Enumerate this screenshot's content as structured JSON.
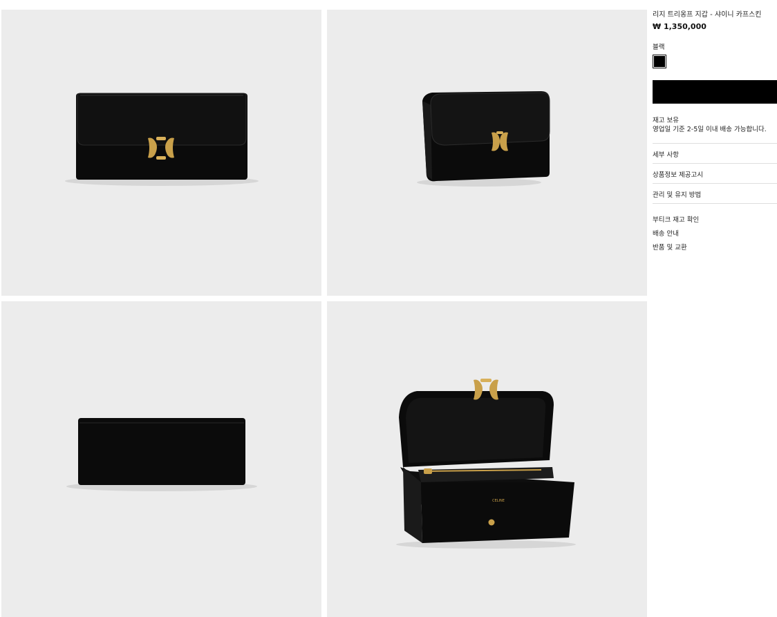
{
  "product": {
    "title": "리지 트리옹프 지갑 - 샤이니 카프스킨",
    "price": "₩ 1,350,000",
    "color_label": "블랙",
    "swatch_color": "#000000",
    "add_button_label": "",
    "stock_status": "재고 보유",
    "shipping_note": "영업일 기준 2-5일 이내 배송 가능합니다."
  },
  "accordion": [
    {
      "label": "세부 사항"
    },
    {
      "label": "상품정보 제공고시"
    },
    {
      "label": "관리 및 유지 방법"
    }
  ],
  "links": [
    {
      "label": "부티크 재고 확인"
    },
    {
      "label": "배송 안내"
    },
    {
      "label": "반품 및 교환"
    }
  ],
  "gallery": {
    "images": [
      {
        "view": "front"
      },
      {
        "view": "side"
      },
      {
        "view": "back"
      },
      {
        "view": "open"
      }
    ],
    "logo_text": "CELINE",
    "colors": {
      "background": "#ececec",
      "leather": "#0b0b0b",
      "hardware": "#c9a04a"
    }
  }
}
